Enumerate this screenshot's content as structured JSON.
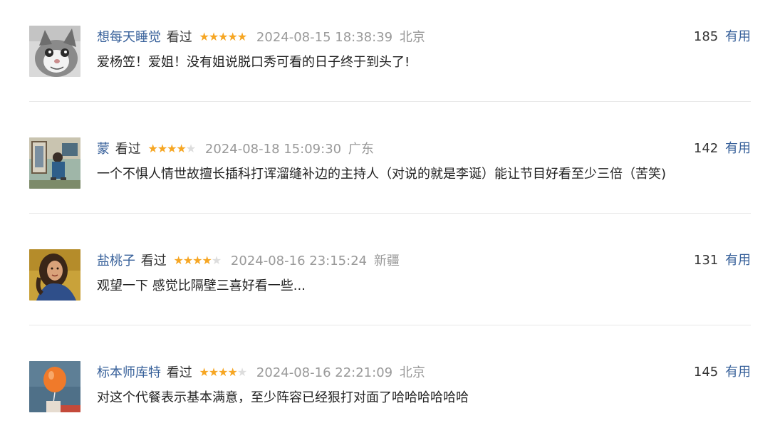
{
  "comments": [
    {
      "user": "想每天睡觉",
      "status": "看过",
      "rating": 5,
      "time": "2024-08-15 18:38:39",
      "location": "北京",
      "votes": "185",
      "vote_label": "有用",
      "text": "爱杨笠！爱姐！没有姐说脱口秀可看的日子终于到头了!",
      "avatar_icon": "cat-avatar"
    },
    {
      "user": "蒙",
      "status": "看过",
      "rating": 4,
      "time": "2024-08-18 15:09:30",
      "location": "广东",
      "votes": "142",
      "vote_label": "有用",
      "text": "一个不惧人情世故擅长插科打诨溜缝补边的主持人（对说的就是李诞）能让节目好看至少三倍（苦笑)",
      "avatar_icon": "painting-avatar"
    },
    {
      "user": "盐桃子",
      "status": "看过",
      "rating": 4,
      "time": "2024-08-16 23:15:24",
      "location": "新疆",
      "votes": "131",
      "vote_label": "有用",
      "text": "观望一下 感觉比隔壁三喜好看一些...",
      "avatar_icon": "portrait-avatar"
    },
    {
      "user": "标本师库特",
      "status": "看过",
      "rating": 4,
      "time": "2024-08-16 22:21:09",
      "location": "北京",
      "votes": "145",
      "vote_label": "有用",
      "text": "对这个代餐表示基本满意，至少阵容已经狠打对面了哈哈哈哈哈哈",
      "avatar_icon": "balloon-avatar"
    }
  ],
  "colors": {
    "link": "#37609a",
    "star": "#f6a623",
    "star_empty": "#dddddd",
    "muted": "#999999"
  }
}
